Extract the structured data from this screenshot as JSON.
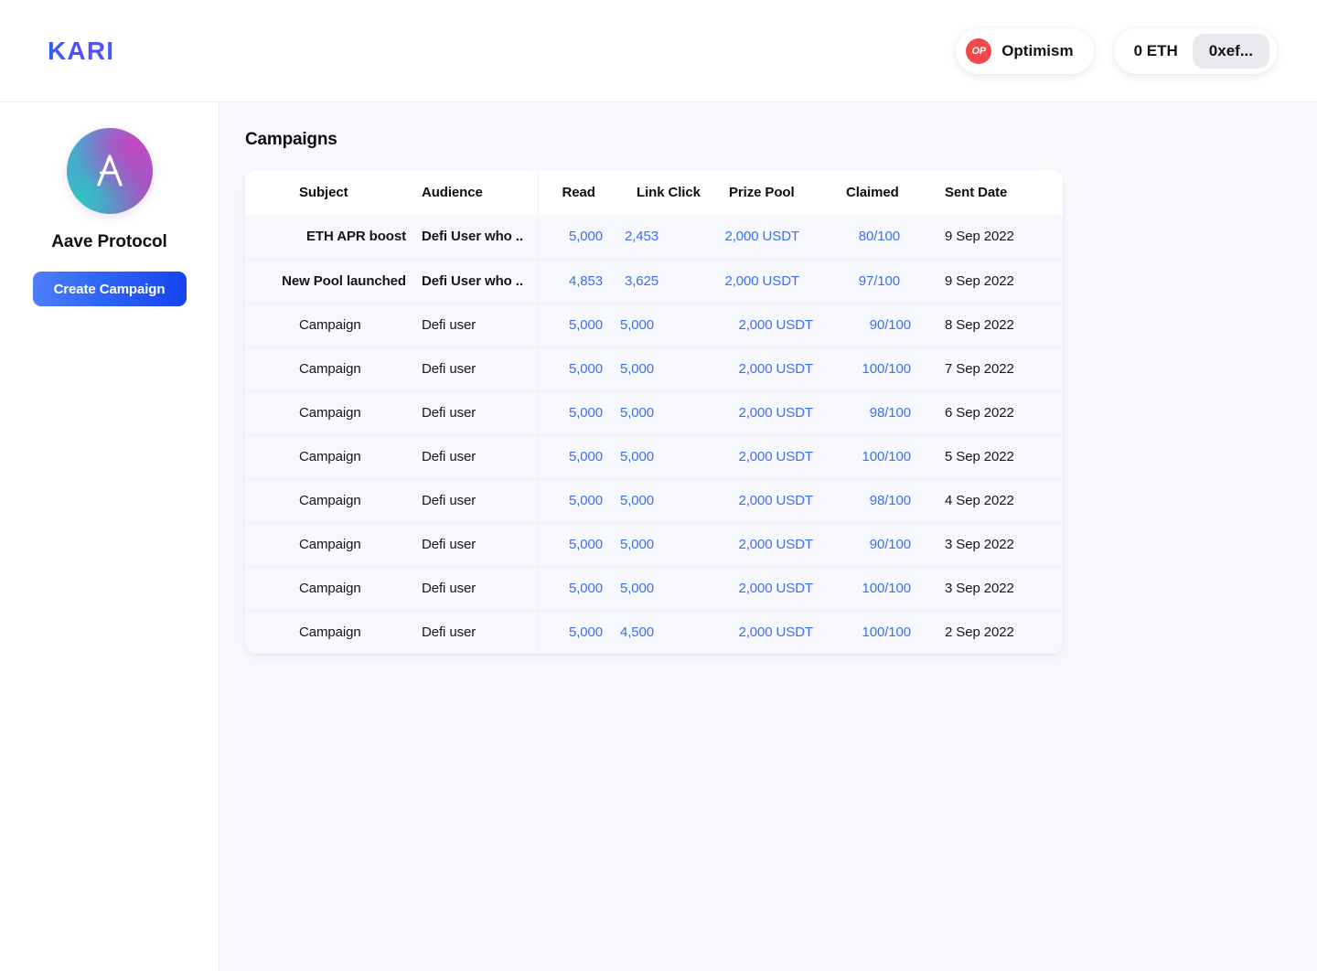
{
  "topnav": {
    "brand": "KARI",
    "chain": {
      "badge_label": "OP",
      "name": "Optimism",
      "badge_color": "#f4474c"
    },
    "wallet": {
      "balance": "0 ETH",
      "address": "0xef..."
    }
  },
  "sidebar": {
    "org_name": "Aave Protocol",
    "create_button": "Create Campaign",
    "logo_name": "aave-logo"
  },
  "main": {
    "page_title": "Campaigns",
    "table": {
      "columns": [
        "Subject",
        "Audience",
        "Read",
        "Link Click",
        "Prize Pool",
        "Claimed",
        "Sent Date"
      ],
      "rows": [
        {
          "highlighted": true,
          "subject": "ETH APR boost",
          "audience": "Defi User who ..",
          "read": "5,000",
          "link_click": "2,453",
          "prize_pool": "2,000 USDT",
          "claimed": "80/100",
          "sent_date": "9 Sep 2022"
        },
        {
          "highlighted": true,
          "subject": "New Pool launched",
          "audience": "Defi User who ..",
          "read": "4,853",
          "link_click": "3,625",
          "prize_pool": "2,000 USDT",
          "claimed": "97/100",
          "sent_date": "9 Sep 2022"
        },
        {
          "highlighted": false,
          "subject": "Campaign",
          "audience": "Defi user",
          "read": "5,000",
          "link_click": "5,000",
          "prize_pool": "2,000 USDT",
          "claimed": "90/100",
          "sent_date": "8 Sep 2022"
        },
        {
          "highlighted": false,
          "subject": "Campaign",
          "audience": "Defi user",
          "read": "5,000",
          "link_click": "5,000",
          "prize_pool": "2,000 USDT",
          "claimed": "100/100",
          "sent_date": "7 Sep 2022"
        },
        {
          "highlighted": false,
          "subject": "Campaign",
          "audience": "Defi user",
          "read": "5,000",
          "link_click": "5,000",
          "prize_pool": "2,000 USDT",
          "claimed": "98/100",
          "sent_date": "6 Sep 2022"
        },
        {
          "highlighted": false,
          "subject": "Campaign",
          "audience": "Defi user",
          "read": "5,000",
          "link_click": "5,000",
          "prize_pool": "2,000 USDT",
          "claimed": "100/100",
          "sent_date": "5 Sep 2022"
        },
        {
          "highlighted": false,
          "subject": "Campaign",
          "audience": "Defi user",
          "read": "5,000",
          "link_click": "5,000",
          "prize_pool": "2,000 USDT",
          "claimed": "98/100",
          "sent_date": "4 Sep 2022"
        },
        {
          "highlighted": false,
          "subject": "Campaign",
          "audience": "Defi user",
          "read": "5,000",
          "link_click": "5,000",
          "prize_pool": "2,000 USDT",
          "claimed": "90/100",
          "sent_date": "3 Sep 2022"
        },
        {
          "highlighted": false,
          "subject": "Campaign",
          "audience": "Defi user",
          "read": "5,000",
          "link_click": "5,000",
          "prize_pool": "2,000 USDT",
          "claimed": "100/100",
          "sent_date": "3 Sep 2022"
        },
        {
          "highlighted": false,
          "subject": "Campaign",
          "audience": "Defi user",
          "read": "5,000",
          "link_click": "4,500",
          "prize_pool": "2,000 USDT",
          "claimed": "100/100",
          "sent_date": "2 Sep 2022"
        }
      ]
    }
  },
  "colors": {
    "brand_blue": "#2b5cf5",
    "link_blue": "#3a6ff0",
    "optimism_red": "#f4474c",
    "page_bg": "#f8f9fc",
    "row_bg": "#f6f8fd"
  }
}
